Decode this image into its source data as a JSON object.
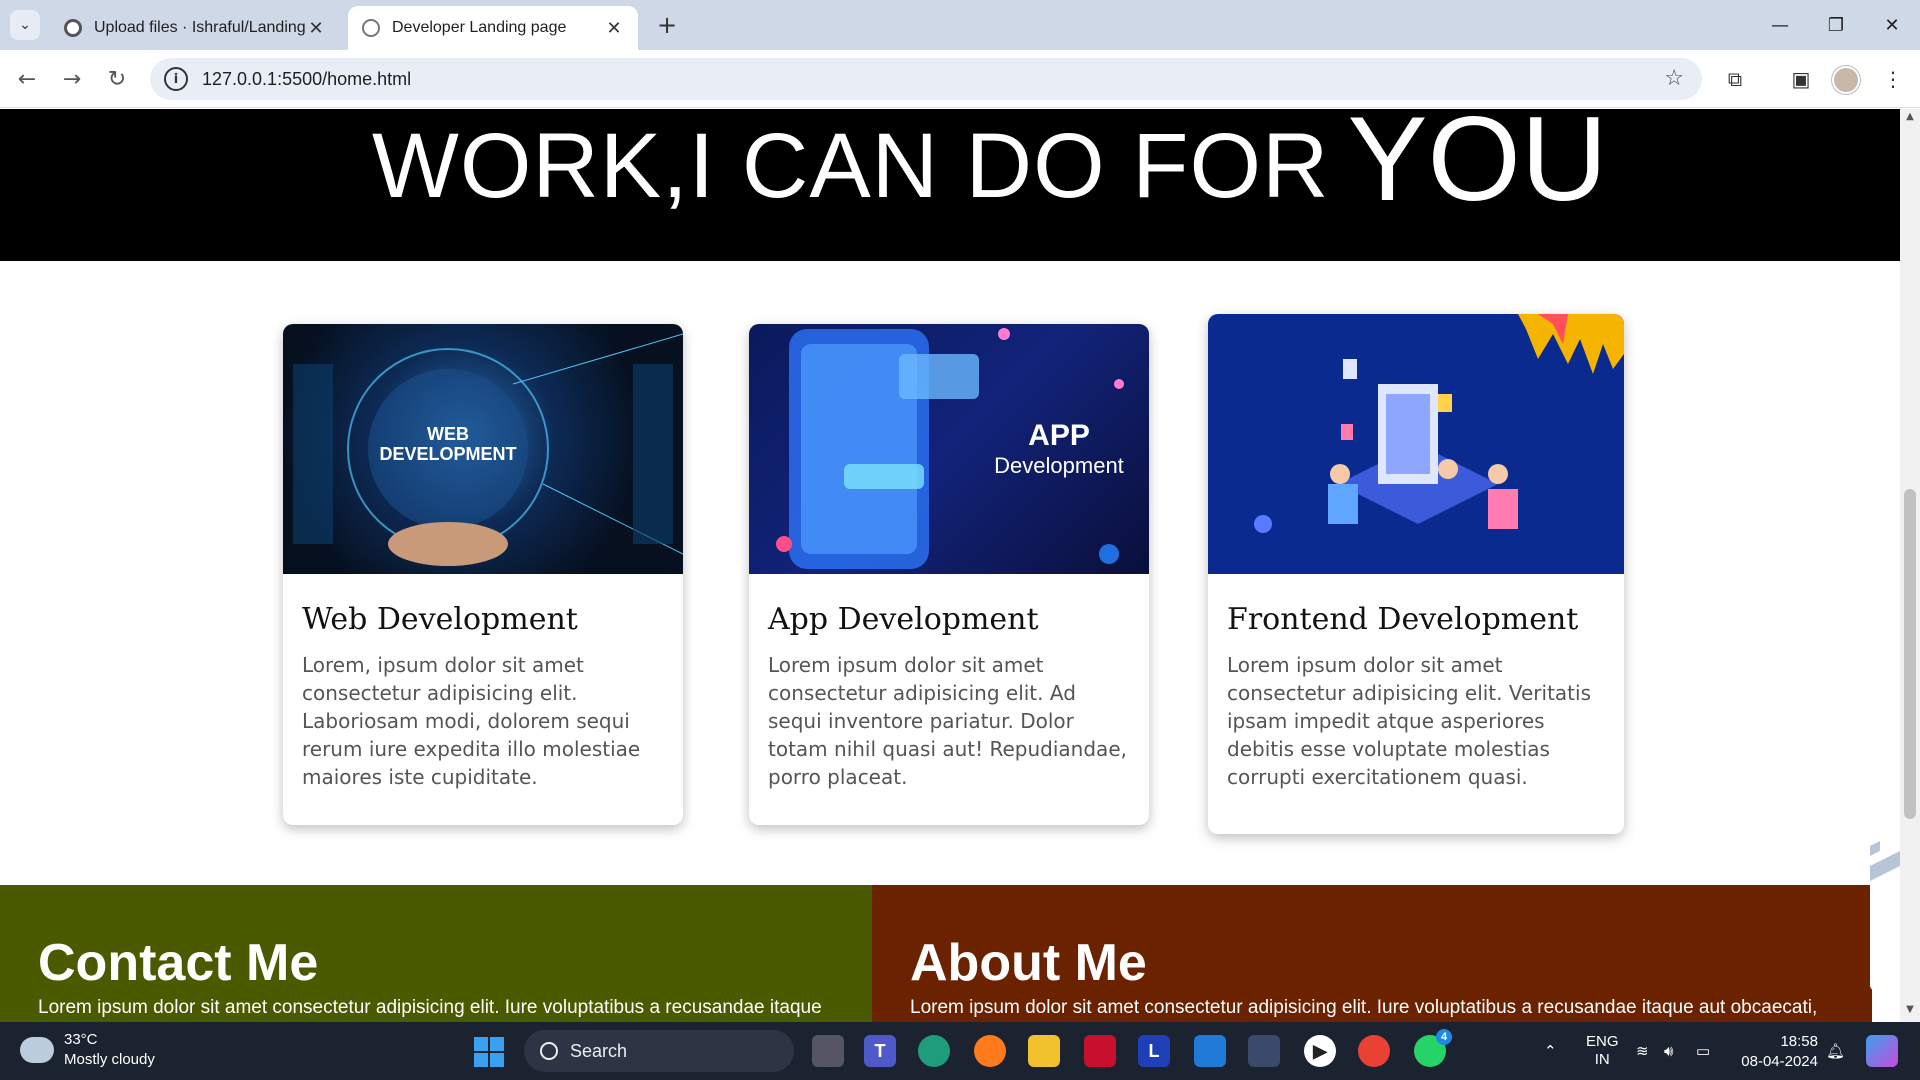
{
  "browser": {
    "tabs": [
      {
        "title": "Upload files · Ishraful/Landing-P",
        "active": false
      },
      {
        "title": "Developer Landing page",
        "active": true
      }
    ],
    "url": "127.0.0.1:5500/home.html"
  },
  "hero": {
    "text_main": "WORK,I CAN DO FOR",
    "text_big": "YOU"
  },
  "cards": [
    {
      "image_label_line1": "WEB",
      "image_label_line2": "DEVELOPMENT",
      "title": "Web Development",
      "text": "Lorem, ipsum dolor sit amet consectetur adipisicing elit. Laboriosam modi, dolorem sequi rerum iure expedita illo molestiae maiores iste cupiditate."
    },
    {
      "image_label_line1": "APP",
      "image_label_line2": "Development",
      "title": "App Development",
      "text": "Lorem ipsum dolor sit amet consectetur adipisicing elit. Ad sequi inventore pariatur. Dolor totam nihil quasi aut! Repudiandae, porro placeat."
    },
    {
      "title": "Frontend Development",
      "text": "Lorem ipsum dolor sit amet consectetur adipisicing elit. Veritatis ipsam impedit atque asperiores debitis esse voluptate molestias corrupti exercitationem quasi."
    }
  ],
  "contact": {
    "title": "Contact Me",
    "text": "Lorem ipsum dolor sit amet consectetur adipisicing elit. Iure voluptatibus a recusandae itaque"
  },
  "about": {
    "title": "About Me",
    "text": "Lorem ipsum dolor sit amet consectetur adipisicing elit. Iure voluptatibus a recusandae itaque aut obcaecati,"
  },
  "taskbar": {
    "weather_temp": "33°C",
    "weather_desc": "Mostly cloudy",
    "search_label": "Search",
    "lang_line1": "ENG",
    "lang_line2": "IN",
    "time": "18:58",
    "date": "08-04-2024",
    "whatsapp_badge": "4"
  },
  "colors": {
    "contact_bg": "#4a5a00",
    "about_bg": "#6b2200",
    "hero_bg": "#000000"
  }
}
